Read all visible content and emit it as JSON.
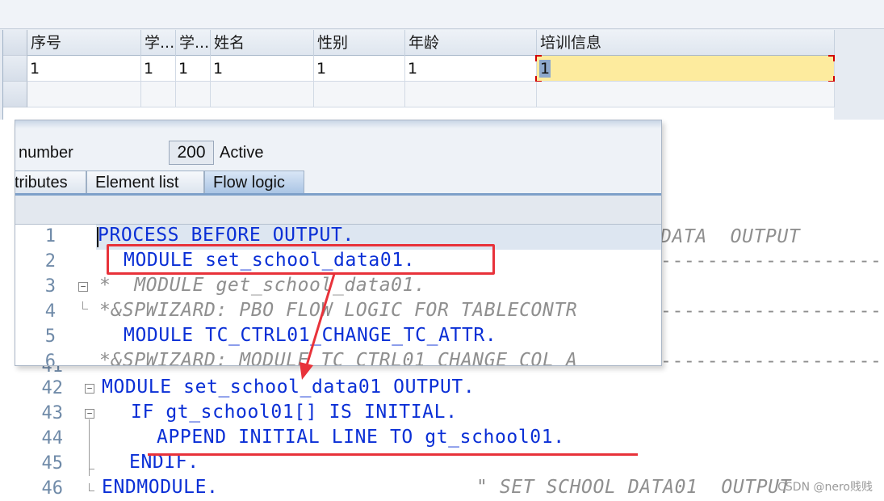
{
  "table": {
    "headers": [
      "序号",
      "学...",
      "学...",
      "姓名",
      "性别",
      "年龄",
      "培训信息"
    ],
    "rows": [
      [
        "1",
        "1",
        "1",
        "1",
        "1",
        "1",
        "1"
      ]
    ]
  },
  "code_editor": {
    "lines": [
      {
        "no": "41",
        "text": "*&SPWIZARD: MODULE TC_CTRL01_CHANGE_COL_A"
      },
      {
        "no": "42",
        "text": "MODULE set_school_data01 OUTPUT."
      },
      {
        "no": "43",
        "text": "IF gt_school01[] IS INITIAL."
      },
      {
        "no": "44",
        "text": "APPEND INITIAL LINE TO gt_school01."
      },
      {
        "no": "45",
        "text": "ENDIF."
      },
      {
        "no": "46",
        "text": "ENDMODULE."
      }
    ],
    "header_comment": "DATA  OUTPUT",
    "end_comment": "\" SET SCHOOL DATA01  OUTPUT"
  },
  "screen_painter": {
    "number_label": "number",
    "number_value": "200",
    "status": "Active",
    "tabs": [
      {
        "label": "tributes",
        "active": false
      },
      {
        "label": "Element list",
        "active": false
      },
      {
        "label": "Flow logic",
        "active": true
      }
    ],
    "lines": [
      {
        "no": "1",
        "text": "PROCESS BEFORE OUTPUT."
      },
      {
        "no": "2",
        "text": "MODULE set_school_data01."
      },
      {
        "no": "3",
        "text": "*  MODULE get_school_data01."
      },
      {
        "no": "4",
        "text": "*&SPWIZARD: PBO FLOW LOGIC FOR TABLECONTR"
      },
      {
        "no": "5",
        "text": "MODULE TC_CTRL01_CHANGE_TC_ATTR."
      },
      {
        "no": "6",
        "text": "*&SPWIZARD: MODULE TC_CTRL01_CHANGE_COL_A"
      }
    ]
  },
  "watermark": "CSDN @nero贱贱",
  "colors": {
    "keyword": "#0a2fd6",
    "comment": "#8f8f8f",
    "annotation": "#e8323a",
    "focus_cell": "#fdeb9e"
  }
}
